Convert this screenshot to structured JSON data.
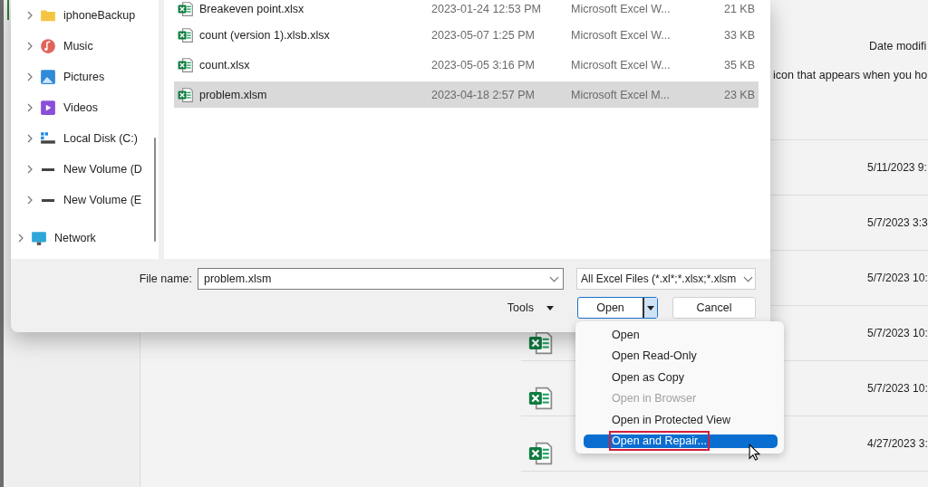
{
  "background": {
    "column_header": "Date modifi",
    "tip_text": "icon that appears when you ho",
    "rows": [
      {
        "date": "5/11/2023 9:"
      },
      {
        "date": "5/7/2023 3:3"
      },
      {
        "date": "5/7/2023 10:"
      },
      {
        "date": "5/7/2023 10:",
        "icon": true
      },
      {
        "date": "5/7/2023 10:",
        "icon": true
      },
      {
        "date": "4/27/2023 3:",
        "icon": true
      }
    ]
  },
  "dialog": {
    "nav": [
      {
        "label": "iphoneBackup",
        "kind": "folder"
      },
      {
        "label": "Music",
        "kind": "music"
      },
      {
        "label": "Pictures",
        "kind": "pictures"
      },
      {
        "label": "Videos",
        "kind": "videos"
      },
      {
        "label": "Local Disk (C:)",
        "kind": "disk"
      },
      {
        "label": "New Volume (D",
        "kind": "drive"
      },
      {
        "label": "New Volume (E",
        "kind": "drive"
      },
      {
        "label": "Network",
        "kind": "network"
      }
    ],
    "files": [
      {
        "name": "Breakeven point.xlsx",
        "date": "2023-01-24 12:53 PM",
        "type": "Microsoft Excel W...",
        "size": "21 KB",
        "selected": false
      },
      {
        "name": "count (version 1).xlsb.xlsx",
        "date": "2023-05-07 1:25 PM",
        "type": "Microsoft Excel W...",
        "size": "33 KB",
        "selected": false
      },
      {
        "name": "count.xlsx",
        "date": "2023-05-05 3:16 PM",
        "type": "Microsoft Excel W...",
        "size": "35 KB",
        "selected": false
      },
      {
        "name": "problem.xlsm",
        "date": "2023-04-18 2:57 PM",
        "type": "Microsoft Excel M...",
        "size": "23 KB",
        "selected": true
      }
    ],
    "file_name_label": "File name:",
    "file_name": "problem.xlsm",
    "filter": "All Excel Files (*.xl*;*.xlsx;*.xlsm",
    "tools": "Tools",
    "open": "Open",
    "cancel": "Cancel"
  },
  "open_menu": [
    {
      "label": "Open",
      "disabled": false,
      "selected": false
    },
    {
      "label": "Open Read-Only",
      "disabled": false,
      "selected": false
    },
    {
      "label": "Open as Copy",
      "disabled": false,
      "selected": false
    },
    {
      "label": "Open in Browser",
      "disabled": true,
      "selected": false
    },
    {
      "label": "Open in Protected View",
      "disabled": false,
      "selected": false
    },
    {
      "label": "Open and Repair...",
      "disabled": false,
      "selected": true
    }
  ]
}
